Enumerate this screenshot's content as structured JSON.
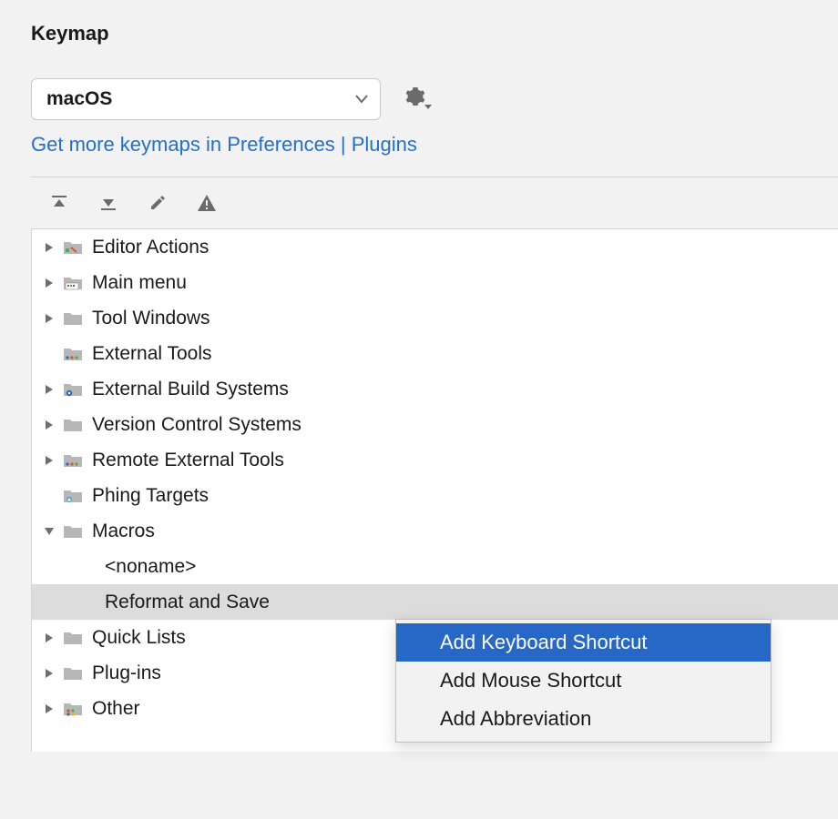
{
  "title": "Keymap",
  "keymap_selector": {
    "selected": "macOS"
  },
  "link_text": "Get more keymaps in Preferences | Plugins",
  "tree": {
    "items": [
      {
        "label": "Editor Actions",
        "icon": "editor"
      },
      {
        "label": "Main menu",
        "icon": "menu"
      },
      {
        "label": "Tool Windows",
        "icon": "plain"
      },
      {
        "label": "External Tools",
        "icon": "dots"
      },
      {
        "label": "External Build Systems",
        "icon": "gear"
      },
      {
        "label": "Version Control Systems",
        "icon": "plain"
      },
      {
        "label": "Remote External Tools",
        "icon": "dots"
      },
      {
        "label": "Phing Targets",
        "icon": "star"
      },
      {
        "label": "Macros",
        "icon": "plain"
      },
      {
        "label": "Quick Lists",
        "icon": "plain"
      },
      {
        "label": "Plug-ins",
        "icon": "plain"
      },
      {
        "label": "Other",
        "icon": "dots-color"
      }
    ],
    "macros_children": [
      {
        "label": "<noname>"
      },
      {
        "label": "Reformat and Save"
      }
    ]
  },
  "context_menu": {
    "items": [
      {
        "label": "Add Keyboard Shortcut"
      },
      {
        "label": "Add Mouse Shortcut"
      },
      {
        "label": "Add Abbreviation"
      }
    ]
  }
}
